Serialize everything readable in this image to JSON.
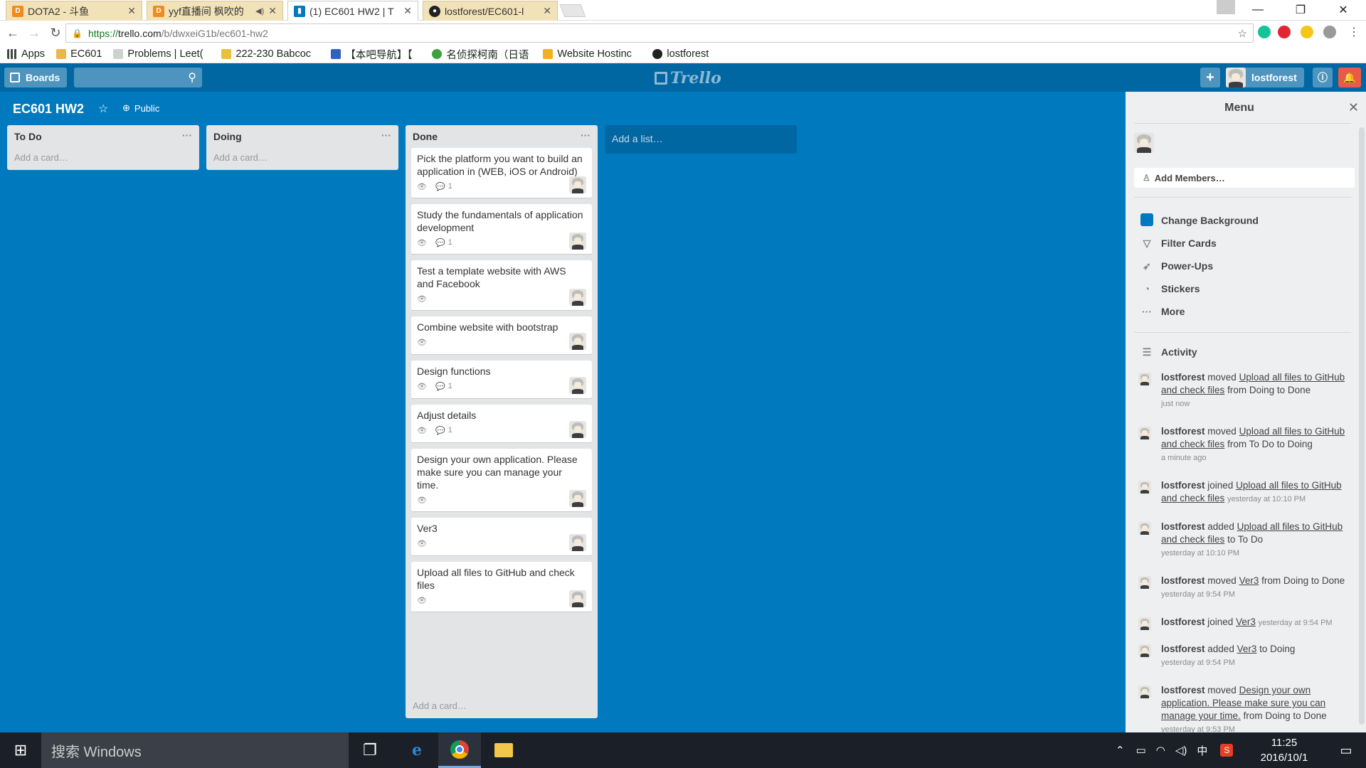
{
  "browser": {
    "tabs": [
      {
        "title": "DOTA2 - 斗鱼",
        "icon": "douyu-icon",
        "color": "#f28b1e"
      },
      {
        "title": "yyf直播间 枫吹的",
        "icon": "douyu-icon",
        "color": "#f28b1e"
      },
      {
        "title": "(1) EC601 HW2 | T",
        "icon": "trello-icon",
        "color": "#0079bf"
      },
      {
        "title": "lostforest/EC601-l",
        "icon": "github-icon",
        "color": "#222222"
      }
    ],
    "url_scheme": "https://",
    "url_host": "trello.com",
    "url_path": "/b/dwxeiG1b/ec601-hw2",
    "bookmarks": [
      {
        "label": "Apps",
        "icon": "apps-grid-icon",
        "color": "#444444"
      },
      {
        "label": "EC601",
        "icon": "folder-icon",
        "color": "#e8b84a"
      },
      {
        "label": "Problems | Leet(",
        "icon": "leetcode-icon",
        "color": "#d0d0d0"
      },
      {
        "label": "222-230 Babcoc",
        "icon": "home-icon",
        "color": "#e8c040"
      },
      {
        "label": "【本吧导航】【",
        "icon": "tieba-icon",
        "color": "#3060c0"
      },
      {
        "label": "名侦探柯南（日语",
        "icon": "play-icon",
        "color": "#40a040"
      },
      {
        "label": "Website Hostinc",
        "icon": "box-icon",
        "color": "#f0b020"
      },
      {
        "label": "lostforest",
        "icon": "github-icon",
        "color": "#222222"
      }
    ]
  },
  "header": {
    "boards_label": "Boards",
    "username": "lostforest",
    "logo_text": "Trello"
  },
  "board": {
    "title": "EC601 HW2",
    "visibility": "Public",
    "add_list": "Add a list…",
    "lists": [
      {
        "name": "To Do",
        "add_card": "Add a card…"
      },
      {
        "name": "Doing",
        "add_card": "Add a card…"
      },
      {
        "name": "Done",
        "add_card": "Add a card…"
      }
    ],
    "done_cards": [
      {
        "title": "Pick the platform you want to build an application in (WEB, iOS or Android)",
        "comments": "1"
      },
      {
        "title": "Study the fundamentals of application development",
        "comments": "1"
      },
      {
        "title": "Test a template website with AWS and Facebook",
        "comments": ""
      },
      {
        "title": "Combine website with bootstrap",
        "comments": ""
      },
      {
        "title": "Design functions",
        "comments": "1"
      },
      {
        "title": "Adjust details",
        "comments": "1"
      },
      {
        "title": "Design your own application. Please make sure you can manage your time.",
        "comments": ""
      },
      {
        "title": "Ver3",
        "comments": ""
      },
      {
        "title": "Upload all files to GitHub and check files",
        "comments": ""
      }
    ]
  },
  "sidebar": {
    "title": "Menu",
    "add_members": "Add Members…",
    "items": [
      {
        "label": "Change Background"
      },
      {
        "label": "Filter Cards"
      },
      {
        "label": "Power-Ups"
      },
      {
        "label": "Stickers"
      },
      {
        "label": "More"
      }
    ],
    "activity_label": "Activity",
    "activity": [
      {
        "user": "lostforest",
        "verb": "moved",
        "link": "Upload all files to GitHub and check files",
        "rest": "from Doing to Done",
        "time": "just now"
      },
      {
        "user": "lostforest",
        "verb": "moved",
        "link": "Upload all files to GitHub and check files",
        "rest": "from To Do to Doing",
        "time": "a minute ago"
      },
      {
        "user": "lostforest",
        "verb": "joined",
        "link": "Upload all files to GitHub and check files",
        "rest": "",
        "time": "yesterday at 10:10 PM"
      },
      {
        "user": "lostforest",
        "verb": "added",
        "link": "Upload all files to GitHub and check files",
        "rest": "to To Do",
        "time": "yesterday at 10:10 PM"
      },
      {
        "user": "lostforest",
        "verb": "moved",
        "link": "Ver3",
        "rest": "from Doing to Done",
        "time": "yesterday at 9:54 PM"
      },
      {
        "user": "lostforest",
        "verb": "joined",
        "link": "Ver3",
        "rest": "",
        "time": "yesterday at 9:54 PM"
      },
      {
        "user": "lostforest",
        "verb": "added",
        "link": "Ver3",
        "rest": "to Doing",
        "time": "yesterday at 9:54 PM"
      },
      {
        "user": "lostforest",
        "verb": "moved",
        "link": "Design your own application. Please make sure you can manage your time.",
        "rest": "from Doing to Done",
        "time": "yesterday at 9:53 PM"
      }
    ]
  },
  "taskbar": {
    "search_placeholder": "搜索 Windows",
    "ime": "中",
    "time": "11:25",
    "date": "2016/10/1"
  },
  "colors": {
    "board_bg": "#0079bf",
    "header_bg": "#0067a3",
    "notification": "#eb5a46"
  }
}
